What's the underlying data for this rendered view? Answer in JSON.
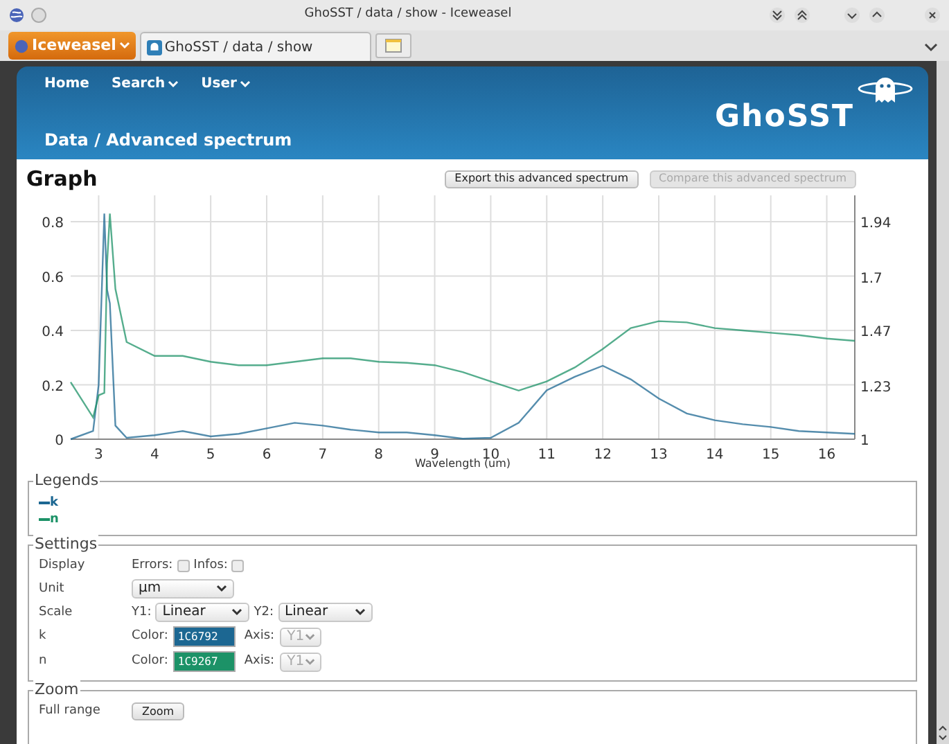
{
  "window": {
    "title": "GhoSST / data / show - Iceweasel"
  },
  "browser": {
    "menu_button": "Iceweasel",
    "tabs": [
      {
        "label": "GhoSST / data / show",
        "selected": true
      }
    ]
  },
  "nav": [
    {
      "label": "Home",
      "dropdown": false
    },
    {
      "label": "Search",
      "dropdown": true
    },
    {
      "label": "User",
      "dropdown": true
    }
  ],
  "logo": "GhoSST",
  "breadcrumb": "Data / Advanced spectrum",
  "graph": {
    "title": "Graph",
    "buttons": [
      {
        "label": "Export this advanced spectrum",
        "disabled": false
      },
      {
        "label": "Compare this advanced spectrum",
        "disabled": true
      }
    ],
    "chart_data": {
      "type": "line",
      "xlabel": "Wavelength (um)",
      "x": [
        2.5,
        2.9,
        3.0,
        3.1,
        3.15,
        3.2,
        3.3,
        3.5,
        4,
        4.5,
        5,
        5.5,
        6,
        6.5,
        7,
        7.5,
        8,
        8.5,
        9,
        9.5,
        10,
        10.5,
        11,
        11.5,
        12,
        12.5,
        13,
        13.5,
        14,
        14.5,
        15,
        15.5,
        16,
        16.5
      ],
      "series": [
        {
          "name": "k",
          "color": "#1c6792",
          "values": [
            0,
            0.03,
            0.2,
            0.83,
            0.55,
            0.5,
            0.05,
            0.005,
            0.015,
            0.03,
            0.01,
            0.02,
            0.04,
            0.06,
            0.05,
            0.035,
            0.025,
            0.025,
            0.015,
            0.002,
            0.005,
            0.06,
            0.18,
            0.23,
            0.27,
            0.22,
            0.15,
            0.095,
            0.07,
            0.055,
            0.045,
            0.03,
            0.025,
            0.02
          ]
        },
        {
          "name": "n",
          "color": "#1c9267",
          "axis": "y2",
          "values": [
            1.247,
            1.094,
            1.19,
            1.2,
            1.76,
            1.975,
            1.65,
            1.42,
            1.36,
            1.36,
            1.335,
            1.32,
            1.32,
            1.335,
            1.35,
            1.35,
            1.335,
            1.33,
            1.32,
            1.29,
            1.25,
            1.21,
            1.25,
            1.31,
            1.39,
            1.48,
            1.51,
            1.505,
            1.48,
            1.47,
            1.46,
            1.45,
            1.435,
            1.425
          ]
        }
      ],
      "grid": true,
      "xlim": [
        2.5,
        16.5
      ],
      "ylim": [
        0,
        0.897
      ],
      "y2lim": [
        1,
        2.054
      ],
      "xticks": [
        3,
        4,
        5,
        6,
        7,
        8,
        9,
        10,
        11,
        12,
        13,
        14,
        15,
        16
      ],
      "yticks": [
        0,
        0.2,
        0.4,
        0.6,
        0.8
      ],
      "y2ticks": [
        1,
        1.23,
        1.47,
        1.7,
        1.94
      ]
    }
  },
  "legends": {
    "title": "Legends"
  },
  "settings": {
    "title": "Settings",
    "display": {
      "label": "Display",
      "checks": [
        {
          "label": "Errors:",
          "checked": false
        },
        {
          "label": "Infos:",
          "checked": false
        }
      ]
    },
    "unit": {
      "label": "Unit",
      "value": "µm"
    },
    "scale": {
      "label": "Scale",
      "selects": [
        {
          "label": "Y1:",
          "value": "Linear"
        },
        {
          "label": "Y2:",
          "value": "Linear"
        }
      ]
    },
    "series": [
      {
        "label": "k",
        "color_label": "Color:",
        "color_value": "1C6792",
        "color": "#1c6792",
        "axis_label": "Axis:",
        "axis_value": "Y1",
        "disabled": true
      },
      {
        "label": "n",
        "color_label": "Color:",
        "color_value": "1C9267",
        "color": "#1c9267",
        "axis_label": "Axis:",
        "axis_value": "Y1",
        "disabled": true
      }
    ]
  },
  "zoom": {
    "title": "Zoom",
    "rows": [
      {
        "label": "Full range",
        "button": "Zoom"
      }
    ]
  }
}
